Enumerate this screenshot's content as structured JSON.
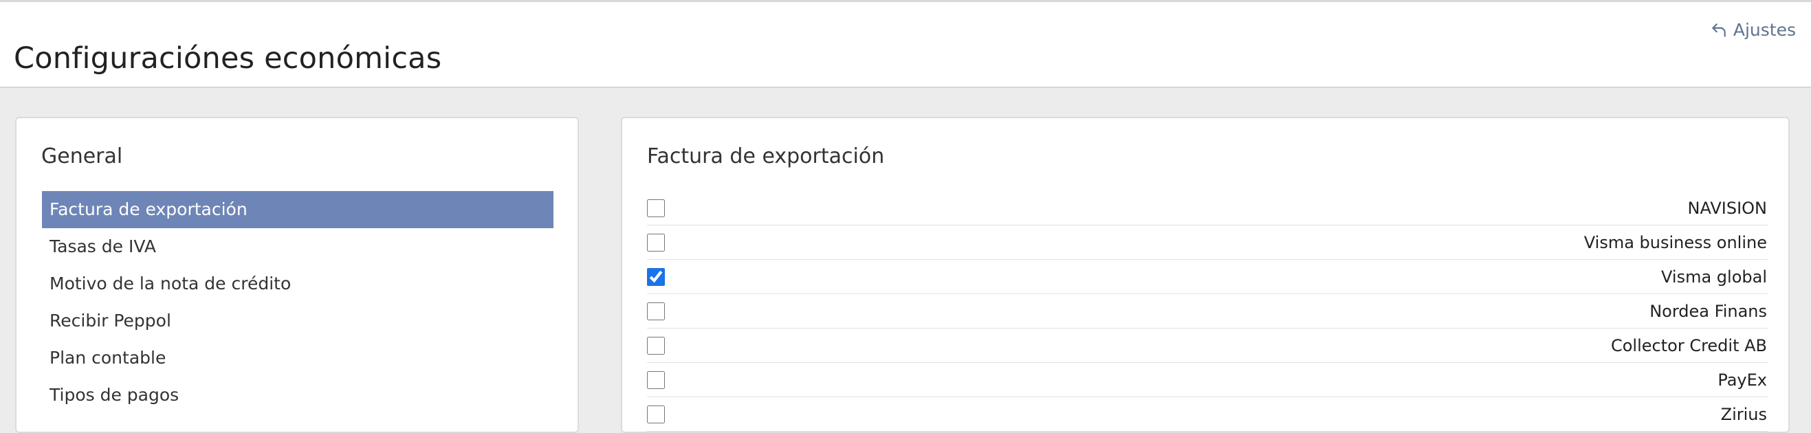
{
  "header": {
    "title": "Configuraciónes económicas",
    "settings_link": "Ajustes",
    "settings_icon": "undo-arrow-icon"
  },
  "sidebar": {
    "heading": "General",
    "items": [
      {
        "label": "Factura de exportación",
        "active": true
      },
      {
        "label": "Tasas de IVA",
        "active": false
      },
      {
        "label": "Motivo de la nota de crédito",
        "active": false
      },
      {
        "label": "Recibir Peppol",
        "active": false
      },
      {
        "label": "Plan contable",
        "active": false
      },
      {
        "label": "Tipos de pagos",
        "active": false
      }
    ]
  },
  "main": {
    "heading": "Factura de exportación",
    "options": [
      {
        "label": "NAVISION",
        "checked": false
      },
      {
        "label": "Visma business online",
        "checked": false
      },
      {
        "label": "Visma global",
        "checked": true
      },
      {
        "label": "Nordea Finans",
        "checked": false
      },
      {
        "label": "Collector Credit AB",
        "checked": false
      },
      {
        "label": "PayEx",
        "checked": false
      },
      {
        "label": "Zirius",
        "checked": false
      }
    ]
  },
  "colors": {
    "active_item_bg": "#6e85b7",
    "link": "#5f7390",
    "page_bg": "#ececec"
  }
}
